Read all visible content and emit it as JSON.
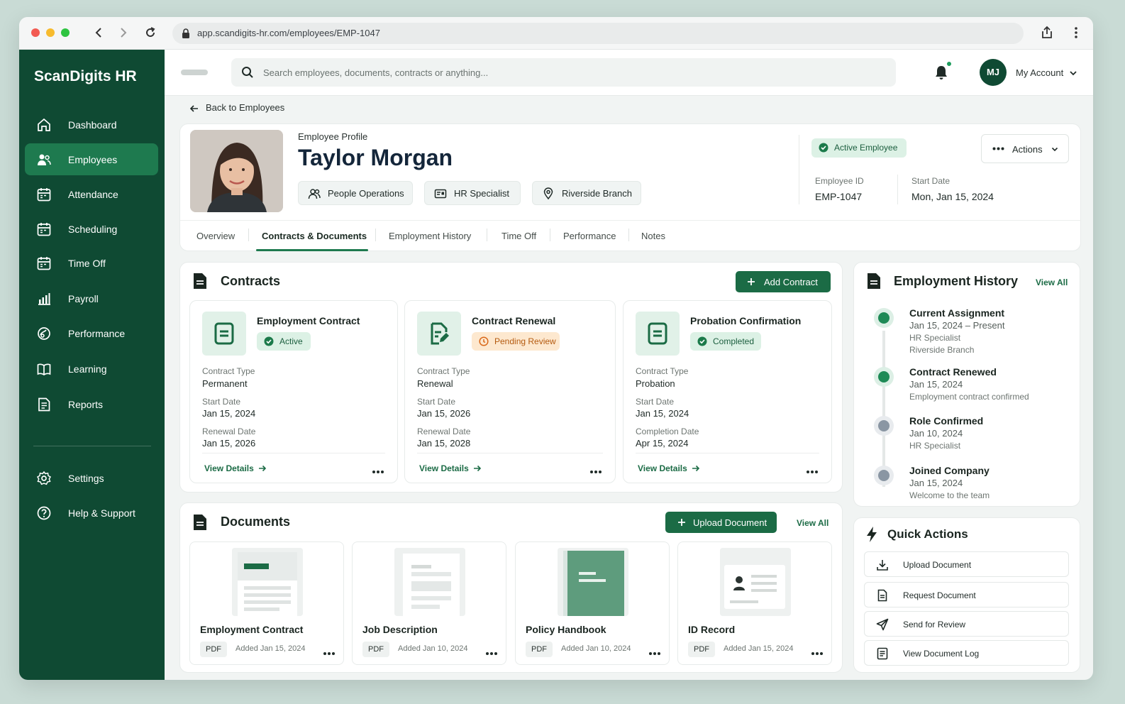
{
  "browser": {
    "url": "app.scandigits-hr.com/employees/EMP-1047"
  },
  "app": {
    "brand": "ScanDigits HR"
  },
  "sidebar": {
    "items": [
      {
        "label": "Dashboard",
        "icon": "home-icon"
      },
      {
        "label": "Employees",
        "icon": "users-icon"
      },
      {
        "label": "Attendance",
        "icon": "calendar-icon"
      },
      {
        "label": "Scheduling",
        "icon": "calendar-icon"
      },
      {
        "label": "Time Off",
        "icon": "calendar-icon"
      },
      {
        "label": "Payroll",
        "icon": "bar-chart-icon"
      },
      {
        "label": "Performance",
        "icon": "performance-icon"
      },
      {
        "label": "Learning",
        "icon": "book-icon"
      },
      {
        "label": "Reports",
        "icon": "report-icon"
      }
    ],
    "bottom": [
      {
        "label": "Settings",
        "icon": "gear-icon"
      },
      {
        "label": "Help & Support",
        "icon": "help-icon"
      }
    ],
    "active": "Employees"
  },
  "topbar": {
    "search_placeholder": "Search employees, documents, contracts or anything...",
    "avatar_initials": "MJ",
    "account_label": "My Account"
  },
  "breadcrumb": {
    "back_label": "Back to Employees"
  },
  "profile": {
    "kicker": "Employee Profile",
    "name": "Taylor Morgan",
    "department": "People Operations",
    "role": "HR Specialist",
    "location": "Riverside Branch",
    "status": "Active Employee",
    "actions_label": "Actions",
    "employee_id_label": "Employee ID",
    "employee_id": "EMP-1047",
    "start_date_label": "Start Date",
    "start_date": "Mon, Jan 15, 2024"
  },
  "tabs": [
    "Overview",
    "Contracts & Documents",
    "Employment History",
    "Time Off",
    "Performance",
    "Notes"
  ],
  "contracts": {
    "title": "Contracts",
    "add_label": "Add Contract",
    "view_details": "View Details",
    "items": [
      {
        "title": "Employment Contract",
        "status": "Active",
        "status_kind": "active",
        "f1_label": "Contract Type",
        "f1": "Permanent",
        "f2_label": "Start Date",
        "f2": "Jan 15, 2024",
        "f3_label": "Renewal Date",
        "f3": "Jan 15, 2026"
      },
      {
        "title": "Contract Renewal",
        "status": "Pending Review",
        "status_kind": "pending",
        "f1_label": "Contract Type",
        "f1": "Renewal",
        "f2_label": "Start Date",
        "f2": "Jan 15, 2026",
        "f3_label": "Renewal Date",
        "f3": "Jan 15, 2028"
      },
      {
        "title": "Probation Confirmation",
        "status": "Completed",
        "status_kind": "active",
        "f1_label": "Contract Type",
        "f1": "Probation",
        "f2_label": "Start Date",
        "f2": "Jan 15, 2024",
        "f3_label": "Completion Date",
        "f3": "Apr 15, 2024"
      }
    ]
  },
  "documents": {
    "title": "Documents",
    "upload_label": "Upload Document",
    "view_all": "View All",
    "items": [
      {
        "title": "Employment Contract",
        "type": "PDF",
        "added": "Added Jan 15, 2024"
      },
      {
        "title": "Job Description",
        "type": "PDF",
        "added": "Added Jan 10, 2024"
      },
      {
        "title": "Policy Handbook",
        "type": "PDF",
        "added": "Added Jan 10, 2024"
      },
      {
        "title": "ID Record",
        "type": "PDF",
        "added": "Added Jan 15, 2024"
      }
    ]
  },
  "history": {
    "title": "Employment History",
    "view_all": "View All",
    "items": [
      {
        "title": "Current Assignment",
        "date": "Jan 15, 2024 – Present",
        "line1": "HR Specialist",
        "line2": "Riverside Branch",
        "color": "#1e8a56"
      },
      {
        "title": "Contract Renewed",
        "date": "Jan 15, 2024",
        "line1": "Employment contract confirmed",
        "color": "#1e8a56"
      },
      {
        "title": "Role Confirmed",
        "date": "Jan 10, 2024",
        "line1": "HR Specialist",
        "color": "#8a96a3"
      },
      {
        "title": "Joined Company",
        "date": "Jan 15, 2024",
        "line1": "Welcome to the team",
        "color": "#8a96a3"
      }
    ]
  },
  "quick_actions": {
    "title": "Quick Actions",
    "items": [
      {
        "label": "Upload Document",
        "icon": "download-icon"
      },
      {
        "label": "Request Document",
        "icon": "document-icon"
      },
      {
        "label": "Send for Review",
        "icon": "send-icon"
      },
      {
        "label": "View Document Log",
        "icon": "log-icon"
      }
    ]
  },
  "colors": {
    "sidebar": "#0f4a33",
    "accent": "#1b6b45",
    "active_nav": "#1e7a4f"
  }
}
